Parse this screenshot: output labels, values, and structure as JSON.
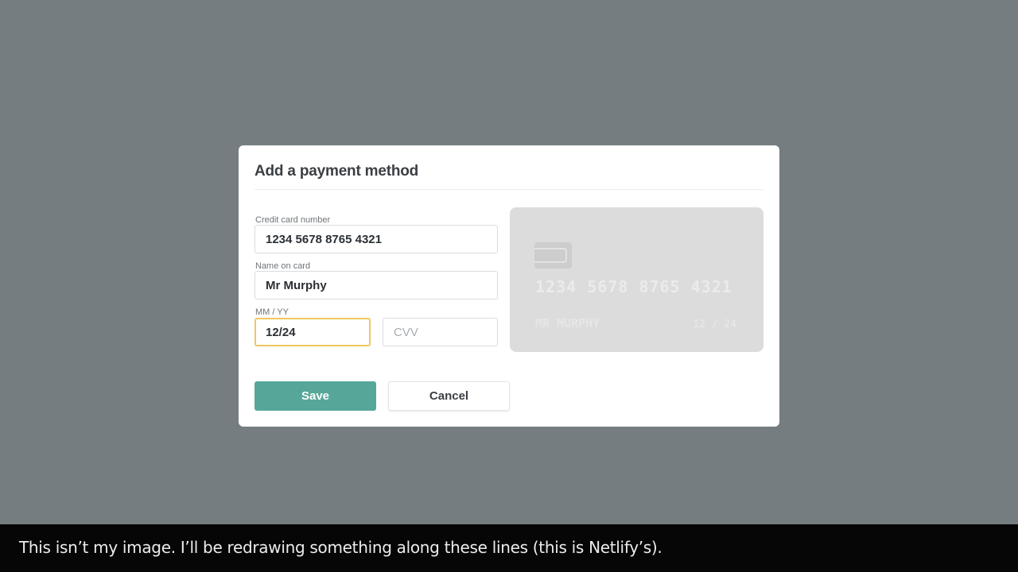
{
  "modal": {
    "title": "Add a payment method",
    "card_number_label": "Credit card number",
    "card_number_value": "1234 5678 8765 4321",
    "name_label": "Name on card",
    "name_value": "Mr Murphy",
    "expiry_label": "MM / YY",
    "expiry_value": "12/24",
    "cvv_placeholder": "CVV",
    "cvv_value": "",
    "save_label": "Save",
    "cancel_label": "Cancel"
  },
  "card_preview": {
    "number": "1234 5678 8765 4321",
    "name": "MR MURPHY",
    "expiry": "12 / 24",
    "chip_icon": "card-chip-icon"
  },
  "caption": {
    "text": "This isn’t my image. I’ll be redrawing something along these lines (this is Netlify’s)."
  },
  "colors": {
    "backdrop": "#767d80",
    "save_button": "#56a79a",
    "focus_border": "#f0c75e",
    "card_background": "#dcdcdc"
  }
}
